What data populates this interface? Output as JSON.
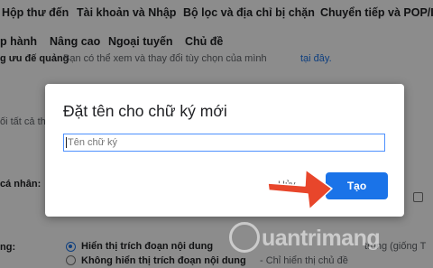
{
  "settings_tabs_row1": [
    "Hộp thư đến",
    "Tài khoản và Nhập",
    "Bộ lọc và địa chỉ bị chặn",
    "Chuyển tiếp và POP/IMAP"
  ],
  "settings_tabs_row2": [
    "p hành",
    "Nâng cao",
    "Ngoại tuyến",
    "Chủ đề"
  ],
  "background": {
    "ad_line_label": "g ưu đế quảng",
    "ad_line_text": "Bạn có thể xem và thay đổi tùy chọn của mình",
    "ad_line_link": "tại đây.",
    "line_left": "ối tất cả th",
    "personal_label": "cá nhân:",
    "snippet_label": "ng:",
    "snippet_option_1": "Hiển thị trích đoạn nội dung",
    "snippet_option_1_tail": "trong (giống T",
    "snippet_option_2": "Không hiển thị trích đoạn nội dung",
    "snippet_option_2_tail": "- Chỉ hiển thị chủ đề"
  },
  "dialog": {
    "title": "Đặt tên cho chữ ký mới",
    "input_placeholder": "Tên chữ ký",
    "input_value": "",
    "cancel_label": "Hủy",
    "create_label": "Tạo"
  },
  "watermark": {
    "text": "uantrimang"
  },
  "colors": {
    "primary_button": "#1a73e8",
    "arrow": "#e8462b",
    "overlay": "rgba(0,0,0,0.45)"
  }
}
